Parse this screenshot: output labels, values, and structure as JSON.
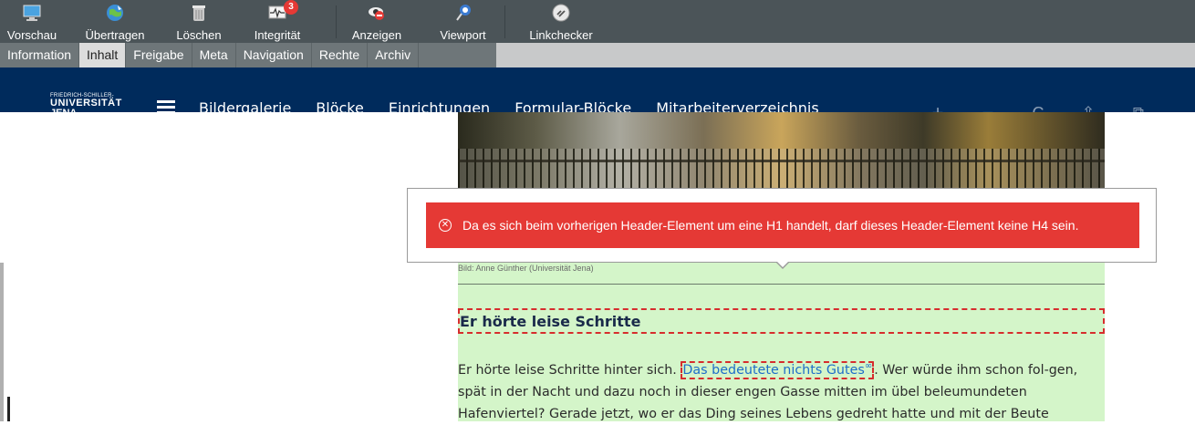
{
  "toolbar": {
    "items": [
      {
        "label": "Vorschau",
        "icon": "monitor-icon"
      },
      {
        "label": "Übertragen",
        "icon": "globe-icon"
      },
      {
        "label": "Löschen",
        "icon": "trash-icon"
      },
      {
        "label": "Integrität",
        "icon": "pulse-monitor-icon",
        "badge": "3"
      },
      {
        "label": "Anzeigen",
        "icon": "eye-icon"
      },
      {
        "label": "Viewport",
        "icon": "viewport-pin-icon"
      },
      {
        "label": "Linkchecker",
        "icon": "link-check-icon"
      }
    ]
  },
  "tabs": {
    "items": [
      "Information",
      "Inhalt",
      "Freigabe",
      "Meta",
      "Navigation",
      "Rechte",
      "Archiv"
    ],
    "active": "Inhalt"
  },
  "site": {
    "logo": {
      "line1": "FRIEDRICH-SCHILLER-",
      "line2": "UNIVERSITÄT",
      "line3": "JENA"
    },
    "nav": [
      "Bildergalerie",
      "Blöcke",
      "Einrichtungen",
      "Formular-Blöcke",
      "Mitarbeiterverzeichnis"
    ],
    "controls": [
      "+",
      "−",
      "C",
      "⇪",
      "⧉"
    ]
  },
  "page": {
    "caption": "Bild: Anne Günther (Universität Jena)",
    "heading": "Er hörte leise Schritte",
    "paragraph": {
      "before": "Er hörte leise Schritte hinter sich. ",
      "link": "Das bedeutete nichts Gutes",
      "after": ". Wer würde ihm schon fol-gen, spät in der Nacht und dazu noch in dieser engen Gasse mitten im übel beleumundeten Hafenviertel? Gerade jetzt, wo er das Ding seines Lebens gedreht hatte und mit der Beute"
    }
  },
  "error": {
    "message": "Da es sich beim vorherigen Header-Element um eine H1 handelt, darf dieses Header-Element keine H4 sein."
  },
  "colors": {
    "toolbar_bg": "#4b5458",
    "nav_bg": "#002b5c",
    "error_bg": "#e53935",
    "content_bg": "#d4f5c9",
    "link": "#1e6ec9"
  }
}
